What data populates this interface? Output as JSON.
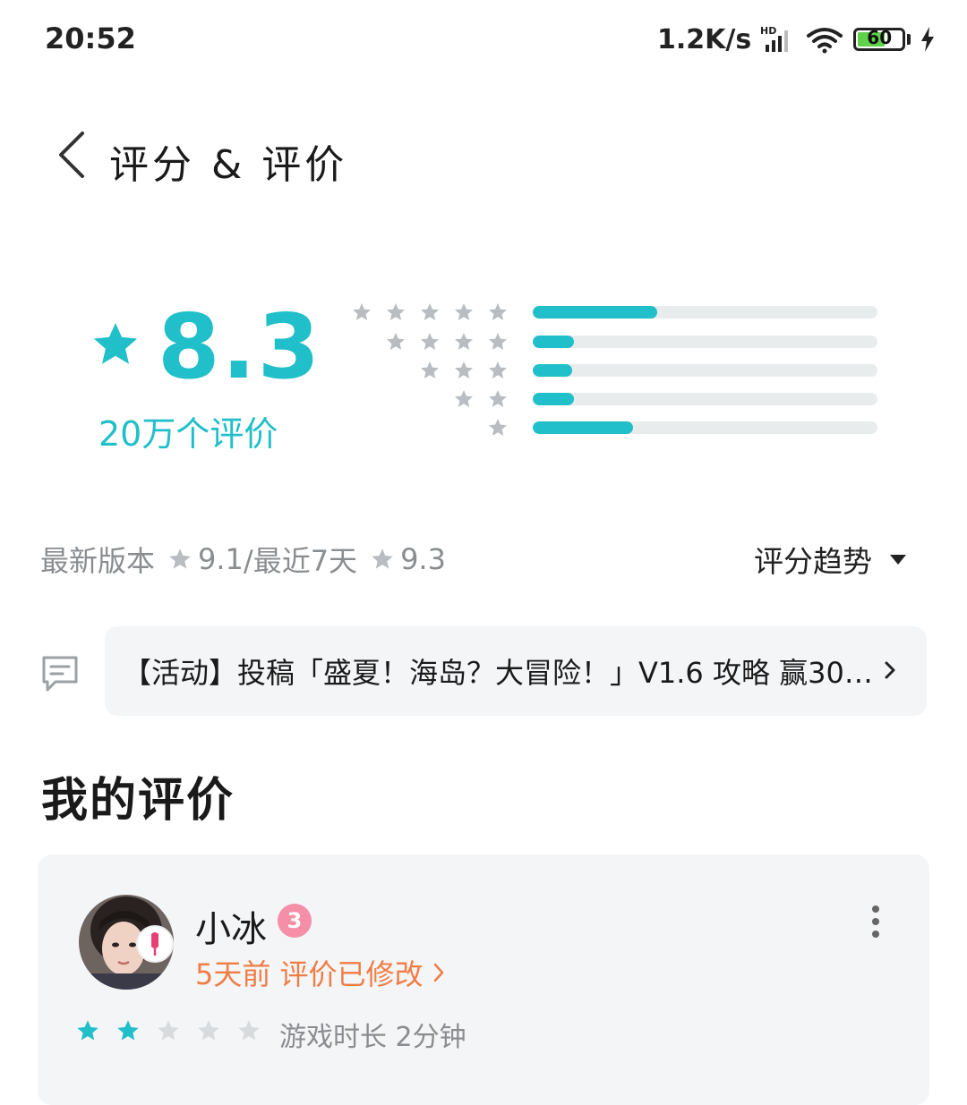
{
  "status_bar": {
    "time": "20:52",
    "net_speed": "1.2K/s",
    "net_type": "HD",
    "battery_level": "60",
    "icons": [
      "signal-icon",
      "wifi-icon",
      "battery-icon",
      "charging-icon"
    ]
  },
  "header": {
    "title": "评分 & 评价"
  },
  "rating": {
    "score": "8.3",
    "review_count": "20万个评价",
    "distribution": [
      {
        "stars": 5,
        "fraction": 0.36
      },
      {
        "stars": 4,
        "fraction": 0.12
      },
      {
        "stars": 3,
        "fraction": 0.115
      },
      {
        "stars": 2,
        "fraction": 0.12
      },
      {
        "stars": 1,
        "fraction": 0.29
      }
    ]
  },
  "version_line": {
    "latest_label": "最新版本",
    "latest_score": "9.1",
    "recent_label": "/最近7天",
    "recent_score": "9.3",
    "trend_label": "评分趋势"
  },
  "activity": {
    "text": "【活动】投稿「盛夏！海岛？大冒险！」V1.6 攻略 赢30…"
  },
  "my_review": {
    "section_title": "我的评价",
    "username": "小冰",
    "level": "3",
    "time_text": "5天前 评价已修改",
    "rating": 2,
    "max_rating": 5,
    "playtime": "游戏时长 2分钟"
  },
  "colors": {
    "accent": "#20bfc9",
    "orange": "#f07d45",
    "star_gray": "#b9bdc1",
    "bar_bg": "#e8eced"
  }
}
